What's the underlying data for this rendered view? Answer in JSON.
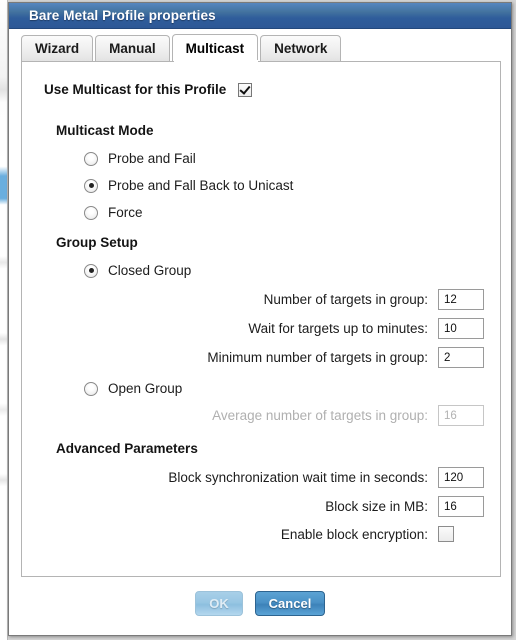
{
  "window": {
    "title": "Bare Metal Profile properties"
  },
  "tabs": [
    {
      "label": "Wizard",
      "active": false
    },
    {
      "label": "Manual",
      "active": false
    },
    {
      "label": "Multicast",
      "active": true
    },
    {
      "label": "Network",
      "active": false
    }
  ],
  "use_multicast": {
    "label": "Use Multicast for this Profile",
    "checked": true
  },
  "multicast_mode": {
    "heading": "Multicast Mode",
    "options": [
      {
        "label": "Probe and Fail",
        "selected": false
      },
      {
        "label": "Probe and Fall Back to Unicast",
        "selected": true
      },
      {
        "label": "Force",
        "selected": false
      }
    ]
  },
  "group_setup": {
    "heading": "Group Setup",
    "closed_group": {
      "label": "Closed Group",
      "selected": true,
      "fields": [
        {
          "label": "Number of targets in group:",
          "value": "12",
          "disabled": false
        },
        {
          "label": "Wait for targets up to minutes:",
          "value": "10",
          "disabled": false
        },
        {
          "label": "Minimum number of targets in group:",
          "value": "2",
          "disabled": false
        }
      ]
    },
    "open_group": {
      "label": "Open Group",
      "selected": false,
      "fields": [
        {
          "label": "Average number of targets in group:",
          "value": "16",
          "disabled": true
        }
      ]
    }
  },
  "advanced_parameters": {
    "heading": "Advanced Parameters",
    "fields": [
      {
        "label": "Block synchronization wait time in seconds:",
        "value": "120",
        "type": "text",
        "disabled": false
      },
      {
        "label": "Block size in MB:",
        "value": "16",
        "type": "text",
        "disabled": false
      },
      {
        "label": "Enable block encryption:",
        "value": "",
        "type": "checkbox",
        "checked": false
      }
    ]
  },
  "footer": {
    "ok_label": "OK",
    "ok_disabled": true,
    "cancel_label": "Cancel"
  },
  "colors": {
    "titlebar_top": "#5686c0",
    "titlebar_bottom": "#2d5896",
    "primary_button": "#4a91c6",
    "disabled_text": "#b2b2b2"
  }
}
